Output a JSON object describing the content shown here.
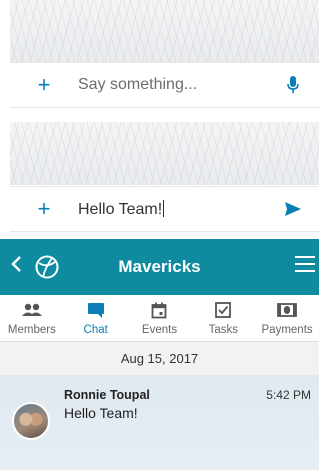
{
  "composer_empty": {
    "placeholder": "Say something...",
    "trailing_icon": "microphone-icon"
  },
  "composer_filled": {
    "value": "Hello Team!",
    "trailing_icon": "send-icon"
  },
  "header": {
    "title": "Mavericks",
    "back_icon": "chevron-left-icon",
    "logo_icon": "team-logo-icon",
    "menu_icon": "hamburger-menu-icon"
  },
  "tabs": [
    {
      "label": "Members",
      "icon": "members-icon",
      "active": false
    },
    {
      "label": "Chat",
      "icon": "chat-icon",
      "active": true
    },
    {
      "label": "Events",
      "icon": "calendar-icon",
      "active": false
    },
    {
      "label": "Tasks",
      "icon": "checkbox-icon",
      "active": false
    },
    {
      "label": "Payments",
      "icon": "payments-icon",
      "active": false
    }
  ],
  "chat": {
    "date": "Aug 15, 2017",
    "messages": [
      {
        "sender": "Ronnie Toupal",
        "text": "Hello Team!",
        "time": "5:42 PM"
      }
    ]
  },
  "colors": {
    "accent": "#0a7fb5",
    "header_bg": "#0e8b9f"
  }
}
